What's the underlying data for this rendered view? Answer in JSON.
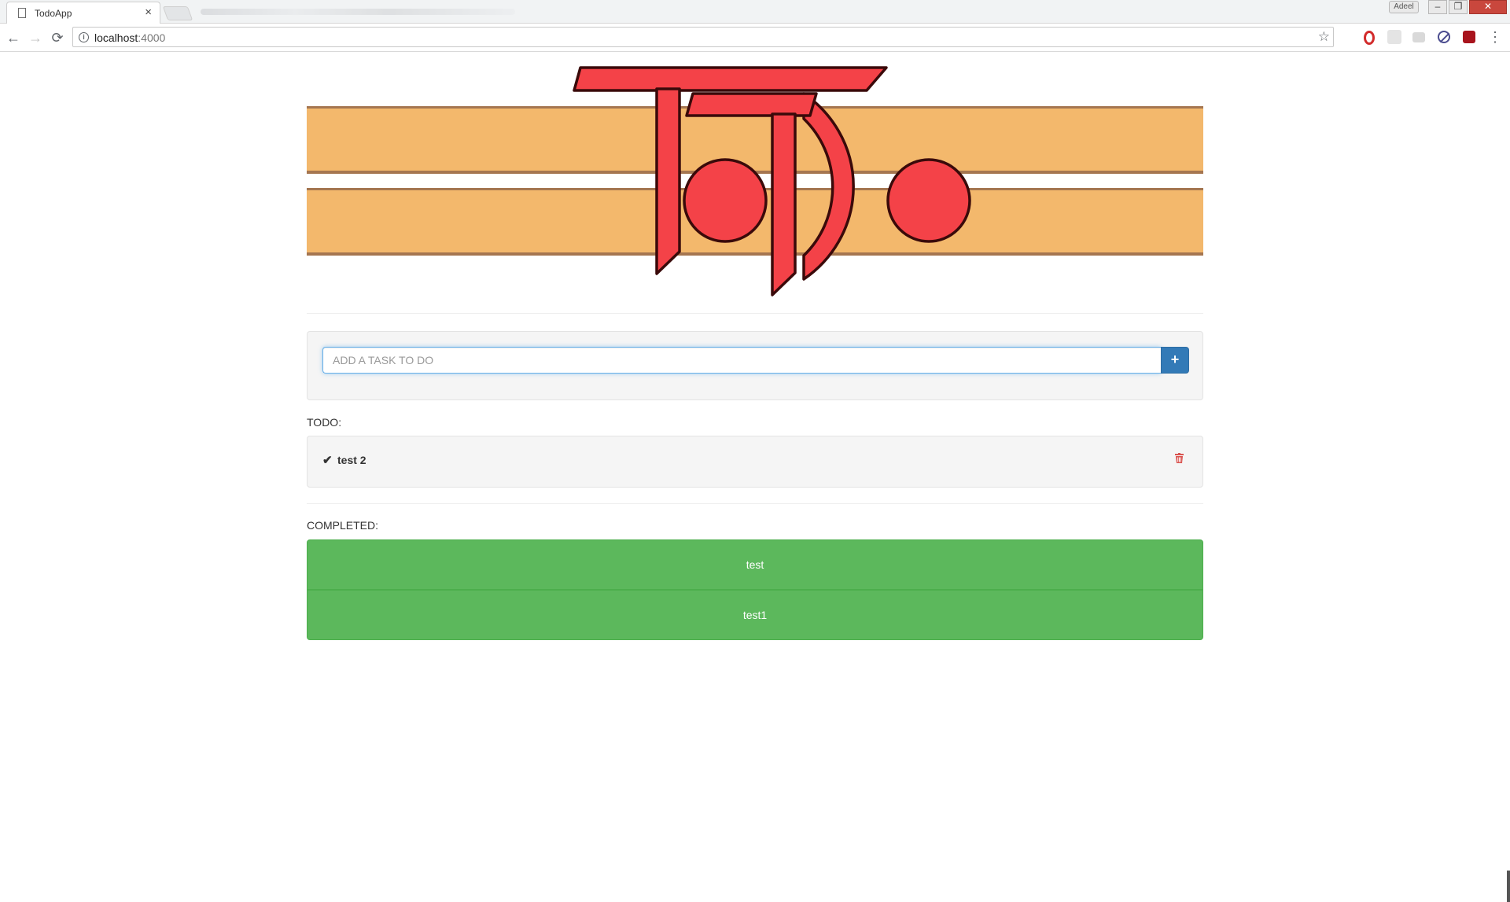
{
  "browser": {
    "tab_title": "TodoApp",
    "tab_close": "×",
    "profile_name": "Adeel",
    "url_host": "localhost",
    "url_port": ":4000",
    "window_controls": {
      "minimize": "–",
      "maximize": "❐",
      "close": "✕"
    }
  },
  "icons": {
    "back": "arrow-left-icon",
    "forward": "arrow-right-icon",
    "reload": "reload-icon",
    "star": "star-icon",
    "add": "plus-icon",
    "check": "checkmark-icon",
    "delete": "trash-icon"
  },
  "glyphs": {
    "back": "←",
    "forward": "→",
    "reload": "⟳",
    "star": "☆",
    "info": "i",
    "add": "+",
    "check": "✔",
    "menu": "⋮"
  },
  "colors": {
    "primary": "#337ab7",
    "success": "#5cb85c",
    "danger": "#d9534f",
    "banner_stripe": "#f3b86c",
    "logo_red": "#f44248"
  },
  "add_task": {
    "placeholder": "ADD A TASK TO DO",
    "value": ""
  },
  "todo": {
    "label": "TODO:",
    "items": [
      {
        "text": "test 2"
      }
    ]
  },
  "completed": {
    "label": "COMPLETED:",
    "items": [
      {
        "text": "test"
      },
      {
        "text": "test1"
      }
    ]
  }
}
